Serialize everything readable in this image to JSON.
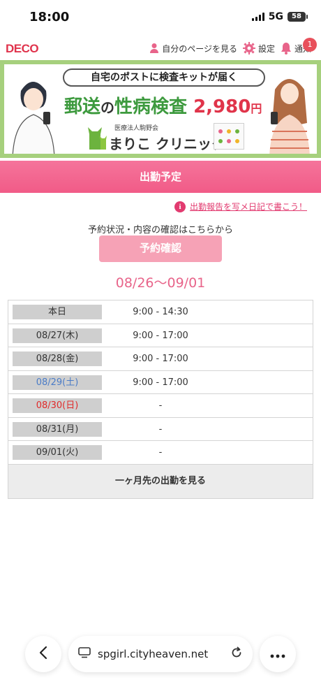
{
  "status": {
    "time": "18:00",
    "network": "5G",
    "battery": "58"
  },
  "header": {
    "logo": "DECO",
    "my_page": "自分のページを見る",
    "settings": "設定",
    "notifications": "通知",
    "notification_count": "1"
  },
  "banner": {
    "tagline": "自宅のポストに検査キットが届く",
    "headline_a": "郵送",
    "headline_b": "の",
    "headline_c": "性病検査",
    "price": "2,980",
    "yen": "円",
    "clinic_corp": "医療法人駒野会",
    "clinic_name": "まりこ クリニック"
  },
  "section_title": "出勤予定",
  "report_link": "出勤報告を写メ日記で書こう！",
  "reserve_note": "予約状況・内容の確認はこちらから",
  "reserve_button": "予約確認",
  "date_range": "08/26〜09/01",
  "schedule": [
    {
      "day": "本日",
      "time": "9:00 - 14:30"
    },
    {
      "day": "08/27(木)",
      "time": "9:00 - 17:00"
    },
    {
      "day": "08/28(金)",
      "time": "9:00 - 17:00"
    },
    {
      "day": "08/29(土)",
      "time": "9:00 - 17:00"
    },
    {
      "day": "08/30(日)",
      "time": "-"
    },
    {
      "day": "08/31(月)",
      "time": "-"
    },
    {
      "day": "09/01(火)",
      "time": "-"
    }
  ],
  "more_button": "一ヶ月先の出勤を見る",
  "browser": {
    "url": "spgirl.cityheaven.net"
  },
  "colors": {
    "accent_pink": "#f15b87",
    "saturday": "#4b7cc7",
    "sunday": "#e02a2a"
  }
}
